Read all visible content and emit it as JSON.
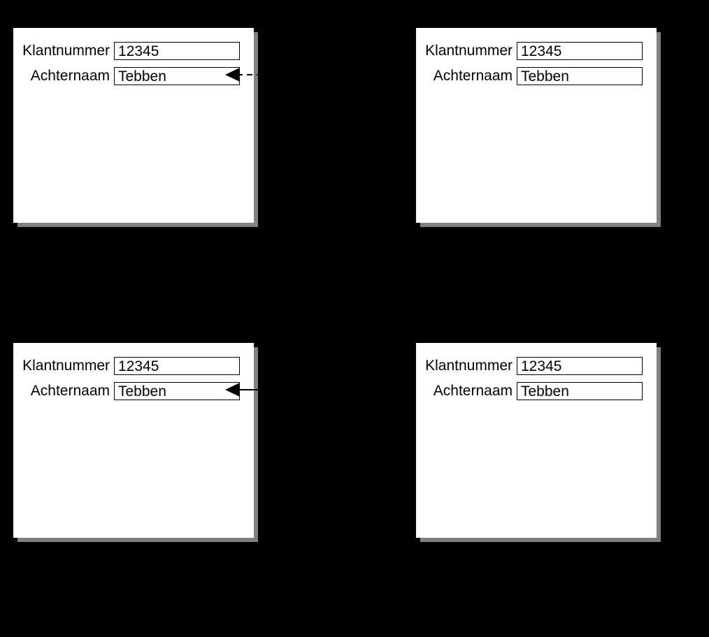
{
  "panels": {
    "tl": {
      "klantnummer_label": "Klantnummer",
      "klantnummer_value": "12345",
      "achternaam_label": "Achternaam",
      "achternaam_value": "Tebben"
    },
    "tr": {
      "klantnummer_label": "Klantnummer",
      "klantnummer_value": "12345",
      "achternaam_label": "Achternaam",
      "achternaam_value": "Tebben"
    },
    "bl": {
      "klantnummer_label": "Klantnummer",
      "klantnummer_value": "12345",
      "achternaam_label": "Achternaam",
      "achternaam_value": "Tebben"
    },
    "br": {
      "klantnummer_label": "Klantnummer",
      "klantnummer_value": "12345",
      "achternaam_label": "Achternaam",
      "achternaam_value": "Tebben"
    }
  }
}
